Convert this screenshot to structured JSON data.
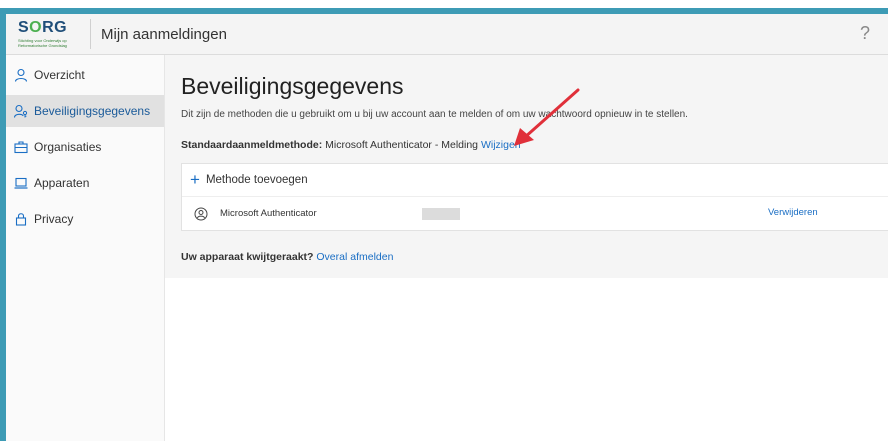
{
  "brand": {
    "logo_text": "SORG",
    "logo_sub1": "Stichting voor Onderwijs op",
    "logo_sub2": "Reformatorische Grondslag"
  },
  "header": {
    "title": "Mijn aanmeldingen",
    "help": "?"
  },
  "sidebar": {
    "items": [
      {
        "label": "Overzicht",
        "icon": "person-icon"
      },
      {
        "label": "Beveiligingsgegevens",
        "icon": "security-info-icon"
      },
      {
        "label": "Organisaties",
        "icon": "briefcase-icon"
      },
      {
        "label": "Apparaten",
        "icon": "laptop-icon"
      },
      {
        "label": "Privacy",
        "icon": "lock-icon"
      }
    ],
    "active_index": 1
  },
  "main": {
    "title": "Beveiligingsgegevens",
    "description": "Dit zijn de methoden die u gebruikt om u bij uw account aan te melden of om uw wachtwoord opnieuw in te stellen.",
    "default_method_label": "Standaardaanmeldmethode:",
    "default_method_value": "Microsoft Authenticator - Melding",
    "change_link": "Wijzigen",
    "add_method": "Methode toevoegen",
    "methods": [
      {
        "name": "Microsoft Authenticator",
        "action": "Verwijderen"
      }
    ],
    "lost_device_label": "Uw apparaat kwijtgeraakt?",
    "lost_device_link": "Overal afmelden"
  },
  "colors": {
    "accent": "#1a6ec4",
    "frame": "#3d9bb5",
    "arrow": "#e0303a"
  }
}
